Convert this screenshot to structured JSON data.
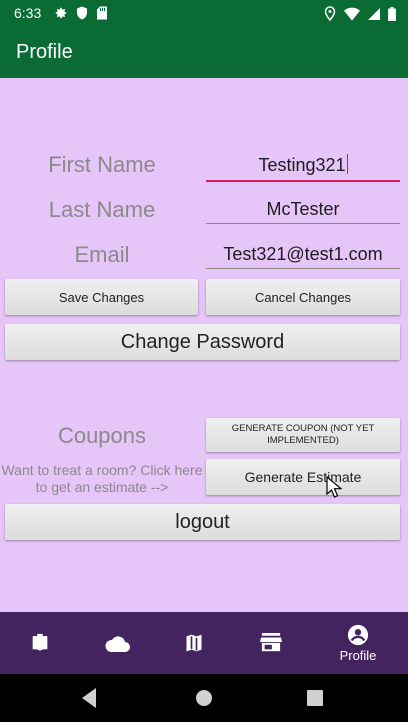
{
  "status_bar": {
    "time": "6:33"
  },
  "app_bar": {
    "title": "Profile"
  },
  "form": {
    "first_name_label": "First Name",
    "first_name_value": "Testing321",
    "last_name_label": "Last Name",
    "last_name_value": "McTester",
    "email_label": "Email",
    "email_value": "Test321@test1.com"
  },
  "buttons": {
    "save_changes": "Save Changes",
    "cancel_changes": "Cancel Changes",
    "change_password": "Change Password",
    "generate_coupon": "GENERATE COUPON (NOT YET IMPLEMENTED)",
    "generate_estimate": "Generate Estimate",
    "logout": "logout"
  },
  "coupons": {
    "label": "Coupons",
    "hint_line1": "Want to treat a room? Click here",
    "hint_line2": "to get an estimate -->"
  },
  "bottom_nav": {
    "items": [
      {
        "icon": "book-icon",
        "label": ""
      },
      {
        "icon": "cloud-icon",
        "label": ""
      },
      {
        "icon": "map-icon",
        "label": ""
      },
      {
        "icon": "store-icon",
        "label": ""
      },
      {
        "icon": "account-circle-icon",
        "label": "Profile"
      }
    ]
  },
  "colors": {
    "app_bar": "#0b6b35",
    "content_bg": "#e6c5f8",
    "bottom_nav": "#43245f",
    "accent": "#d81b60"
  }
}
